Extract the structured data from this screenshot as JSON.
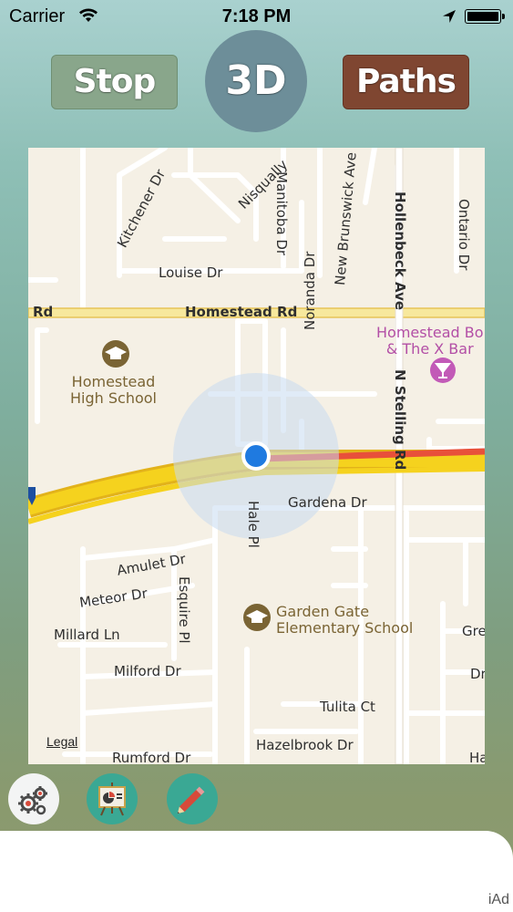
{
  "status_bar": {
    "carrier": "Carrier",
    "time": "7:18 PM"
  },
  "buttons": {
    "stop": "Stop",
    "three_d": "3D",
    "paths": "Paths"
  },
  "map": {
    "streets": {
      "homestead_rd": "Homestead Rd",
      "homestead_rd_left": "Rd",
      "louise_dr": "Louise Dr",
      "kitchener_dr": "Kitchener Dr",
      "nisqually": "Nisqually",
      "manitoba_dr": "Manitoba Dr",
      "new_brunswick_ave": "New Brunswick Ave",
      "hollenbeck_ave": "Hollenbeck Ave",
      "ontario_dr": "Ontario Dr",
      "noranda_dr": "Noranda Dr",
      "n_stelling_rd": "N Stelling Rd",
      "gardena_dr": "Gardena Dr",
      "hale_pl": "Hale Pl",
      "amulet_dr": "Amulet Dr",
      "meteor_dr": "Meteor Dr",
      "esquire_pl": "Esquire Pl",
      "millard_ln": "Millard Ln",
      "milford_dr": "Milford Dr",
      "tulita_ct": "Tulita Ct",
      "hazelbrook_dr": "Hazelbrook Dr",
      "rumford_dr": "Rumford Dr",
      "gre": "Gre",
      "dr_right": "Dr",
      "ha": "Ha"
    },
    "pois": {
      "homestead_high_1": "Homestead",
      "homestead_high_2": "High School",
      "garden_gate_1": "Garden Gate",
      "garden_gate_2": "Elementary School",
      "homestead_bowl_1": "Homestead Bo",
      "homestead_bowl_2": "& The X Bar"
    },
    "legal": "Legal"
  },
  "toolbar": {
    "settings_icon": "gears-icon",
    "chart_icon": "presentation-chart-icon",
    "pencil_icon": "pencil-icon"
  },
  "ad": {
    "label": "iAd"
  },
  "colors": {
    "stop_button": "#89a68b",
    "three_d_button": "#6d8e99",
    "paths_button": "#7f4631",
    "toolbar_teal": "#3aa894",
    "freeway_yellow": "#f5d21e",
    "traffic_red": "#e8503a",
    "location_blue": "#1f7ae0"
  }
}
